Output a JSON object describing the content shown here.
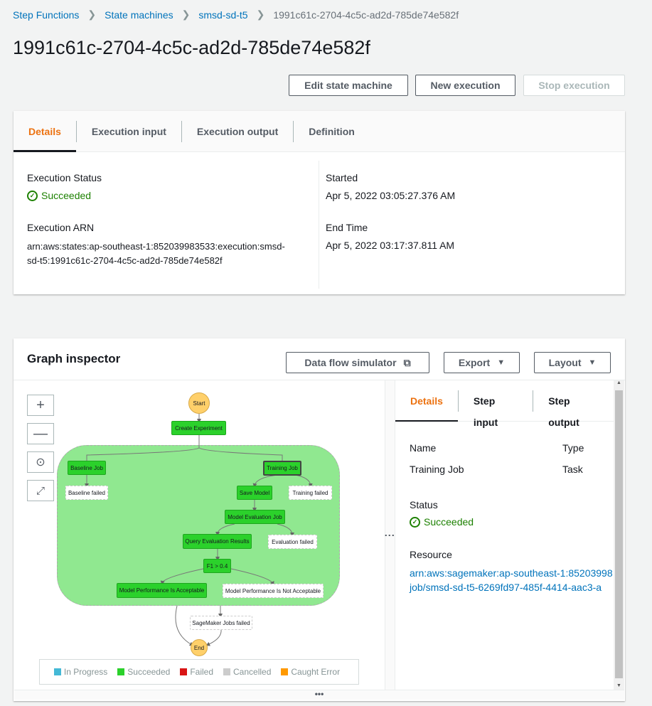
{
  "breadcrumb": [
    "Step Functions",
    "State machines",
    "smsd-sd-t5",
    "1991c61c-2704-4c5c-ad2d-785de74e582f"
  ],
  "title": "1991c61c-2704-4c5c-ad2d-785de74e582f",
  "actions": {
    "edit": "Edit state machine",
    "new": "New execution",
    "stop": "Stop execution"
  },
  "tabs": [
    "Details",
    "Execution input",
    "Execution output",
    "Definition"
  ],
  "details": {
    "status_label": "Execution Status",
    "status_value": "Succeeded",
    "arn_label": "Execution ARN",
    "arn_line1": "arn:aws:states:ap-southeast-1:852039983533:execution:smsd-",
    "arn_line2": "sd-t5:1991c61c-2704-4c5c-ad2d-785de74e582f",
    "started_label": "Started",
    "started_value": "Apr 5, 2022 03:05:27.376 AM",
    "end_label": "End Time",
    "end_value": "Apr 5, 2022 03:17:37.811 AM"
  },
  "graph": {
    "title": "Graph inspector",
    "buttons": {
      "simulator": "Data flow simulator",
      "export": "Export",
      "layout": "Layout"
    },
    "nodes": {
      "start": "Start",
      "create": "Create Experiment",
      "baseline": "Baseline Job",
      "baseline_failed": "Baseline failed",
      "training": "Training Job",
      "save": "Save Model",
      "training_failed": "Training failed",
      "eval": "Model Evaluation Job",
      "query": "Query Evaluation Results",
      "eval_failed": "Evaluation failed",
      "f1": "F1 > 0.4",
      "acceptable": "Model Performance Is Acceptable",
      "not_acceptable": "Model Performance Is Not Acceptable",
      "sm_failed": "SageMaker Jobs failed",
      "end": "End"
    },
    "legend": [
      {
        "label": "In Progress",
        "color": "#44b9d6"
      },
      {
        "label": "Succeeded",
        "color": "#2bd12b"
      },
      {
        "label": "Failed",
        "color": "#d91515"
      },
      {
        "label": "Cancelled",
        "color": "#cccccc"
      },
      {
        "label": "Caught Error",
        "color": "#ff9900"
      }
    ],
    "colors": {
      "succeeded": "#2bd12b",
      "parallel_bg": "#90e890",
      "terminal": "#ffd06a"
    }
  },
  "step": {
    "tabs": [
      "Details",
      "Step input",
      "Step output"
    ],
    "name_label": "Name",
    "name_value": "Training Job",
    "type_label": "Type",
    "type_value": "Task",
    "status_label": "Status",
    "status_value": "Succeeded",
    "resource_label": "Resource",
    "resource_line1": "arn:aws:sagemaker:ap-southeast-1:85203998",
    "resource_line2": "job/smsd-sd-t5-6269fd97-485f-4414-aac3-a"
  }
}
